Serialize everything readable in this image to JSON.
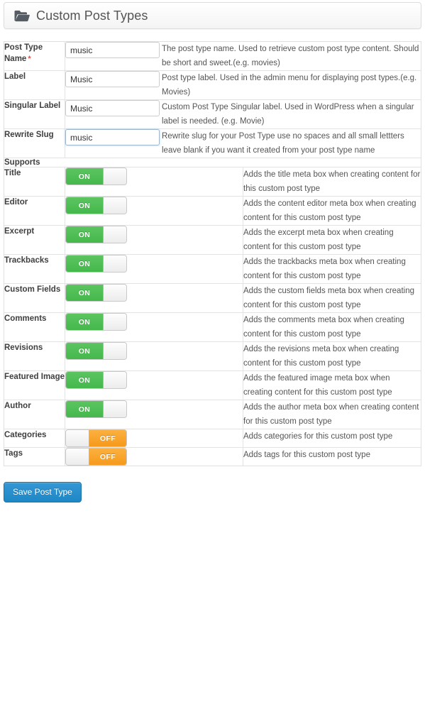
{
  "header": {
    "icon": "folder-open-icon",
    "title": "Custom Post Types"
  },
  "fields": [
    {
      "label": "Post Type Name",
      "required": true,
      "required_marker": "*",
      "value": "music",
      "placeholder": "",
      "description": "The post type name. Used to retrieve custom post type content. Should be short and sweet.(e.g. movies)",
      "focused": false
    },
    {
      "label": "Label",
      "required": false,
      "required_marker": "",
      "value": "Music",
      "placeholder": "",
      "description": "Post type label. Used in the admin menu for displaying post types.(e.g. Movies)",
      "focused": false
    },
    {
      "label": "Singular Label",
      "required": false,
      "required_marker": "",
      "value": "Music",
      "placeholder": "",
      "description": "Custom Post Type Singular label. Used in WordPress when a singular label is needed. (e.g. Movie)",
      "focused": false
    },
    {
      "label": "Rewrite Slug",
      "required": false,
      "required_marker": "",
      "value": "music",
      "placeholder": "",
      "description": "Rewrite slug for your Post Type use no spaces and all small lettters leave blank if you want it created from your post type name",
      "focused": true
    }
  ],
  "supports_section": {
    "title": "Supports"
  },
  "supports": [
    {
      "label": "Title",
      "state": "ON",
      "on": true,
      "description": "Adds the title meta box when creating content for this custom post type"
    },
    {
      "label": "Editor",
      "state": "ON",
      "on": true,
      "description": "Adds the content editor meta box when creating content for this custom post type"
    },
    {
      "label": "Excerpt",
      "state": "ON",
      "on": true,
      "description": "Adds the excerpt meta box when creating content for this custom post type"
    },
    {
      "label": "Trackbacks",
      "state": "ON",
      "on": true,
      "description": "Adds the trackbacks meta box when creating content for this custom post type"
    },
    {
      "label": "Custom Fields",
      "state": "ON",
      "on": true,
      "description": "Adds the custom fields meta box when creating content for this custom post type"
    },
    {
      "label": "Comments",
      "state": "ON",
      "on": true,
      "description": "Adds the comments meta box when creating content for this custom post type"
    },
    {
      "label": "Revisions",
      "state": "ON",
      "on": true,
      "description": "Adds the revisions meta box when creating content for this custom post type"
    },
    {
      "label": "Featured Image",
      "state": "ON",
      "on": true,
      "description": "Adds the featured image meta box when creating content for this custom post type"
    },
    {
      "label": "Author",
      "state": "ON",
      "on": true,
      "description": "Adds the author meta box when creating content for this custom post type"
    },
    {
      "label": "Categories",
      "state": "OFF",
      "on": false,
      "description": "Adds categories for this custom post type"
    },
    {
      "label": "Tags",
      "state": "OFF",
      "on": false,
      "description": "Adds tags for this custom post type"
    }
  ],
  "footer": {
    "save_label": "Save Post Type"
  },
  "colors": {
    "toggle_on": "#4cbb52",
    "toggle_off": "#f59a1b",
    "save_button": "#2389cc",
    "required": "#d9534f",
    "border": "#e3e3e3"
  }
}
